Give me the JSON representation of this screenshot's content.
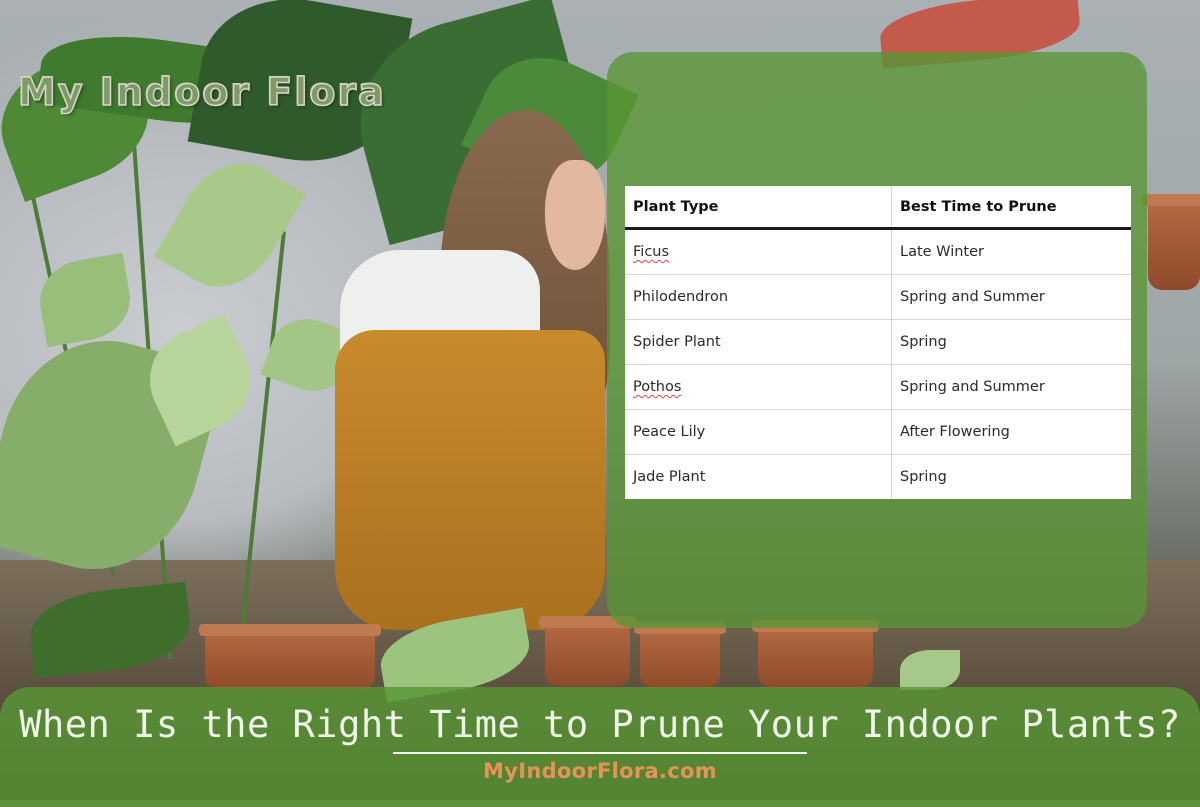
{
  "brand": {
    "logo_text": "My Indoor Flora"
  },
  "table": {
    "headers": [
      "Plant Type",
      "Best Time to Prune"
    ],
    "rows": [
      {
        "plant": "Ficus",
        "time": "Late Winter"
      },
      {
        "plant": "Philodendron",
        "time": "Spring and Summer"
      },
      {
        "plant": "Spider Plant",
        "time": "Spring"
      },
      {
        "plant": "Pothos",
        "time": "Spring and Summer"
      },
      {
        "plant": "Peace Lily",
        "time": "After Flowering"
      },
      {
        "plant": "Jade Plant",
        "time": "Spring"
      }
    ]
  },
  "banner": {
    "title": "When Is the Right Time to Prune Your Indoor Plants?",
    "site_url": "MyIndoorFlora.com"
  },
  "colors": {
    "panel_green": "#589634",
    "url_orange": "#e8925a",
    "title_white": "#f1f6ea"
  }
}
